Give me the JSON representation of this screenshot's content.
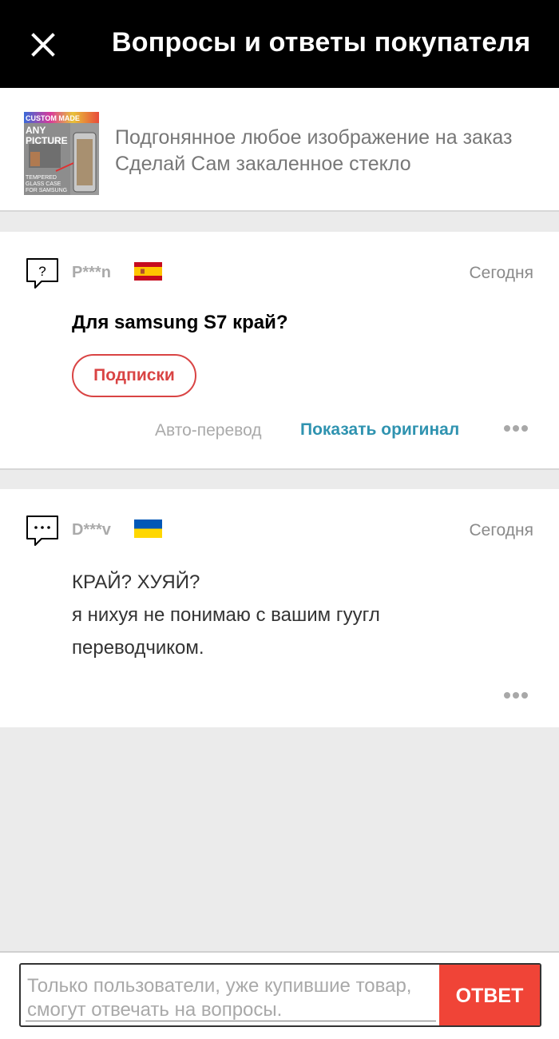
{
  "header": {
    "title": "Вопросы и ответы покупателя",
    "close_icon": "close-icon"
  },
  "product": {
    "title": "Подгонянное любое изображение на заказ Сделай Сам закаленное стекло",
    "thumbnail": {
      "banner_text": "CUSTOM MADE",
      "line1": "ANY",
      "line2": "PICTURE",
      "caption": [
        "TEMPERED",
        "GLASS CASE",
        "FOR SAMSUNG"
      ]
    }
  },
  "question": {
    "icon": "question-bubble-icon",
    "user": "P***n",
    "flag": "spain-flag-icon",
    "date": "Сегодня",
    "text": "Для samsung S7 край?",
    "subscribe_label": "Подписки",
    "auto_translate_label": "Авто-перевод",
    "show_original_label": "Показать оригинал",
    "more_icon": "more-dots-icon"
  },
  "answer": {
    "icon": "answer-bubble-icon",
    "user": "D***v",
    "flag": "ukraine-flag-icon",
    "date": "Сегодня",
    "lines": [
      "КРАЙ? ХУЯЙ?",
      "я нихуя не понимаю с вашим гуугл",
      "переводчиком."
    ],
    "more_icon": "more-dots-icon"
  },
  "reply": {
    "placeholder": "Только пользователи, уже купившие товар, смогут отвечать на вопросы.",
    "button_label": "ОТВЕТ"
  },
  "colors": {
    "header_bg": "#000000",
    "accent_red": "#f04437",
    "link_blue": "#2f93b0",
    "page_bg": "#ebebeb"
  }
}
